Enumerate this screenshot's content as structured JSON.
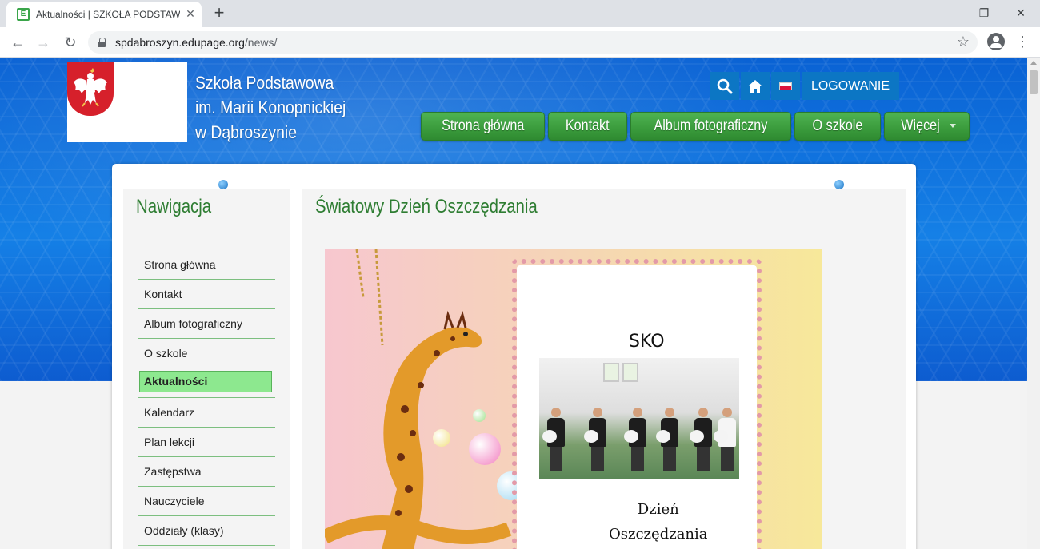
{
  "browser": {
    "tab_title": "Aktualności | SZKOŁA PODSTAWO",
    "tab_close": "✕",
    "new_tab": "+",
    "window_minimize": "—",
    "window_restore": "❐",
    "window_close": "✕",
    "back": "←",
    "forward": "→",
    "reload": "↻",
    "url_host": "spdabroszyn.edupage.org",
    "url_path": "/news/",
    "star": "☆",
    "menu": "⋮"
  },
  "header": {
    "school_name_line1": "Szkoła Podstawowa",
    "school_name_line2": "im. Marii Konopnickiej",
    "school_name_line3": "w Dąbroszynie",
    "login_label": "LOGOWANIE",
    "menu": [
      {
        "label": "Strona główna"
      },
      {
        "label": "Kontakt"
      },
      {
        "label": "Album fotograficzny"
      },
      {
        "label": "O szkole"
      },
      {
        "label": "Więcej"
      }
    ]
  },
  "sidebar": {
    "title": "Nawigacja",
    "items": [
      {
        "label": "Strona główna"
      },
      {
        "label": "Kontakt"
      },
      {
        "label": "Album fotograficzny"
      },
      {
        "label": "O szkole"
      },
      {
        "label": "Aktualności"
      },
      {
        "label": "Kalendarz"
      },
      {
        "label": "Plan lekcji"
      },
      {
        "label": "Zastępstwa"
      },
      {
        "label": "Nauczyciele"
      },
      {
        "label": "Oddziały (klasy)"
      }
    ],
    "active_index": 4
  },
  "article": {
    "title": "Światowy Dzień Oszczędzania",
    "image_text_top": "SKO",
    "image_caption_line1": "Dzień",
    "image_caption_line2": "Oszczędzania"
  },
  "colors": {
    "menu_green": "#3a9b3c",
    "title_green": "#2e7d32",
    "hero_blue": "#1580e6",
    "topbar_blue": "#0c76c4",
    "active_nav": "#8de88f"
  }
}
